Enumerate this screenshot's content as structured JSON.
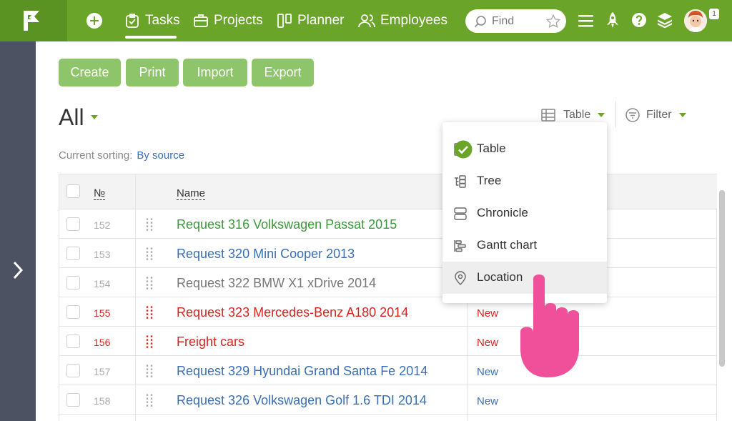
{
  "nav": {
    "items": [
      {
        "label": "Tasks",
        "icon": "clipboard-check-icon"
      },
      {
        "label": "Projects",
        "icon": "briefcase-icon"
      },
      {
        "label": "Planner",
        "icon": "planner-columns-icon"
      },
      {
        "label": "Employees",
        "icon": "people-icon"
      }
    ],
    "search_placeholder": "Find",
    "notification_count": "1"
  },
  "toolbar": {
    "create": "Create",
    "print": "Print",
    "import": "Import",
    "export": "Export"
  },
  "view_title": "All",
  "view_switch": {
    "label": "Table"
  },
  "filter": {
    "label": "Filter"
  },
  "sorting": {
    "label": "Current sorting:",
    "value": "By source"
  },
  "table": {
    "headers": {
      "number": "№",
      "name": "Name"
    },
    "rows": [
      {
        "num": "152",
        "name": "Request 316 Volkswagen Passat 2015",
        "status": "",
        "name_color": "#3a9a3a",
        "num_red": false,
        "grip_red": false
      },
      {
        "num": "153",
        "name": "Request 320 Mini Cooper 2013",
        "status": "",
        "name_color": "#3a6fb5",
        "num_red": false,
        "grip_red": false
      },
      {
        "num": "154",
        "name": "Request 322 BMW X1 xDrive 2014",
        "status": "",
        "name_color": "#777777",
        "num_red": false,
        "grip_red": false
      },
      {
        "num": "155",
        "name": "Request 323 Mercedes-Benz A180 2014",
        "status": "New",
        "name_color": "#d9241e",
        "num_red": true,
        "grip_red": true,
        "status_color": "#d9241e"
      },
      {
        "num": "156",
        "name": "Freight cars",
        "status": "New",
        "name_color": "#d9241e",
        "num_red": true,
        "grip_red": true,
        "status_color": "#d9241e"
      },
      {
        "num": "157",
        "name": "Request 329 Hyundai Grand Santa Fe 2014",
        "status": "New",
        "name_color": "#3a6fb5",
        "num_red": false,
        "grip_red": false,
        "status_color": "#3a6fb5"
      },
      {
        "num": "158",
        "name": "Request 326 Volkswagen Golf 1.6 TDI 2014",
        "status": "New",
        "name_color": "#3a6fb5",
        "num_red": false,
        "grip_red": false,
        "status_color": "#3a6fb5"
      }
    ]
  },
  "view_menu": {
    "items": [
      {
        "label": "Table",
        "icon": "table-icon",
        "selected": true
      },
      {
        "label": "Tree",
        "icon": "tree-icon",
        "selected": false
      },
      {
        "label": "Chronicle",
        "icon": "chronicle-icon",
        "selected": false
      },
      {
        "label": "Gantt chart",
        "icon": "gantt-icon",
        "selected": false
      },
      {
        "label": "Location",
        "icon": "location-pin-icon",
        "selected": false,
        "hovered": true
      }
    ]
  },
  "colors": {
    "brand_green": "#6aa52a",
    "button_green": "#8ec56a",
    "rail": "#4d5263",
    "link_blue": "#3a6fb5",
    "alert_red": "#d9241e",
    "pointer_pink": "#f0509a"
  }
}
